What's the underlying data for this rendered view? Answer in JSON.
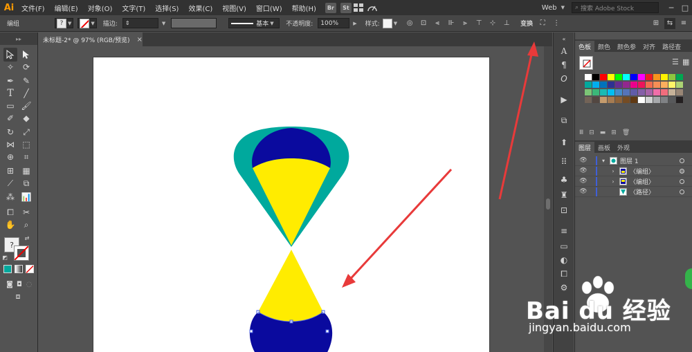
{
  "app": {
    "logo": "Ai"
  },
  "menu": [
    "文件(F)",
    "编辑(E)",
    "对象(O)",
    "文字(T)",
    "选择(S)",
    "效果(C)",
    "视图(V)",
    "窗口(W)",
    "帮助(H)"
  ],
  "badges": [
    "Br",
    "St"
  ],
  "workspace": {
    "label": "Web"
  },
  "stock_search": {
    "placeholder": "搜索 Adobe Stock"
  },
  "control_bar": {
    "selection_type": "编组",
    "stroke_label": "描边:",
    "stroke_profile": "基本",
    "opacity_label": "不透明度:",
    "opacity_value": "100%",
    "style_label": "样式:",
    "transform_label": "变换"
  },
  "document_tab": {
    "title": "未标题-2* @ 97% (RGB/预览)"
  },
  "panels": {
    "top_tabs": [
      "色板",
      "颜色",
      "颜色参",
      "对齐",
      "路径查"
    ],
    "layers_tabs": [
      "图层",
      "画板",
      "外观"
    ]
  },
  "layers": [
    {
      "name": "图层 1",
      "level": 0,
      "expanded": true
    },
    {
      "name": "〈编组〉",
      "level": 1,
      "expanded": false
    },
    {
      "name": "〈编组〉",
      "level": 1,
      "expanded": false
    },
    {
      "name": "〈路径〉",
      "level": 1,
      "expanded": false
    }
  ],
  "colors": {
    "teal": "#00a99d",
    "navy": "#0a0a9e",
    "yellow": "#ffec00",
    "arrow_red": "#e83a3a",
    "accent_orange": "#ff9a00"
  },
  "swatch_rows": [
    [
      "#ffffff",
      "#000000",
      "#ff0000",
      "#ffff00",
      "#00ff00",
      "#00ffff",
      "#0000ff",
      "#ff00ff",
      "#ed1c24",
      "#f7941d",
      "#fff200",
      "#8dc63f",
      "#00a651"
    ],
    [
      "#00a99d",
      "#00aeef",
      "#0072bc",
      "#2e3192",
      "#662d91",
      "#92278f",
      "#ec008c",
      "#ed145b",
      "#f26c4f",
      "#f68e56",
      "#fbaf5d",
      "#fff568",
      "#acd373"
    ],
    [
      "#7cc576",
      "#3bb878",
      "#1abbb4",
      "#00bff3",
      "#438cca",
      "#5574b9",
      "#605ca8",
      "#855fa8",
      "#a763a8",
      "#f06ea9",
      "#f26d7d",
      "#c7b299",
      "#998675"
    ],
    [
      "#736357",
      "#534741",
      "#c69c6d",
      "#a67c52",
      "#8c6239",
      "#754c24",
      "#603913",
      "#ffffff",
      "#d1d3d4",
      "#a7a9ac",
      "#808285",
      "#58595b",
      "#231f20"
    ]
  ],
  "watermark": {
    "brand": "Bai du 经验",
    "url": "jingyan.baidu.com"
  }
}
